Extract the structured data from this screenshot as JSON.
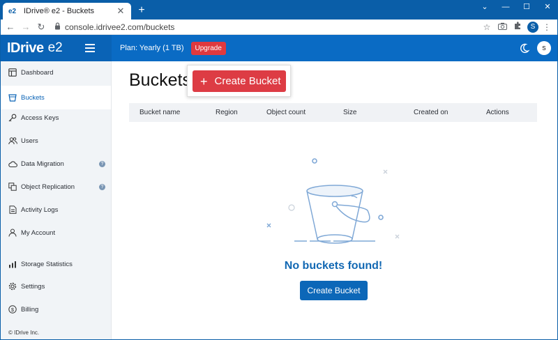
{
  "browser": {
    "tab_title": "IDrive® e2 - Buckets",
    "tab_favicon": "e2",
    "url": "console.idrivee2.com/buckets",
    "profile_initial": "S"
  },
  "header": {
    "logo": "IDrive",
    "logo_suffix": "e2",
    "plan": "Plan: Yearly (1 TB)",
    "upgrade_label": "Upgrade",
    "avatar_initial": "s"
  },
  "sidebar": {
    "items": [
      {
        "label": "Dashboard",
        "icon": "dashboard-icon"
      },
      {
        "label": "Buckets",
        "icon": "bucket-icon",
        "active": true
      },
      {
        "label": "Access Keys",
        "icon": "key-icon"
      },
      {
        "label": "Users",
        "icon": "users-icon"
      },
      {
        "label": "Data Migration",
        "icon": "cloud-icon",
        "help": true
      },
      {
        "label": "Object Replication",
        "icon": "replication-icon",
        "help": true
      },
      {
        "label": "Activity Logs",
        "icon": "log-icon"
      },
      {
        "label": "My Account",
        "icon": "person-icon"
      },
      {
        "label": "Storage Statistics",
        "icon": "chart-icon"
      },
      {
        "label": "Settings",
        "icon": "gear-icon"
      },
      {
        "label": "Billing",
        "icon": "dollar-icon"
      }
    ],
    "help_glyph": "?",
    "copyright": "© IDrive Inc."
  },
  "main": {
    "title": "Buckets",
    "create_popup_label": "Create Bucket",
    "columns": [
      "Bucket name",
      "Region",
      "Object count",
      "Size",
      "Created on",
      "Actions"
    ],
    "empty_message": "No buckets found!",
    "create_button_label": "Create Bucket"
  },
  "colors": {
    "brand_blue": "#0a6bc4",
    "upgrade_red": "#e0393e",
    "create_red": "#dd3c44",
    "empty_text_blue": "#1268b3"
  }
}
